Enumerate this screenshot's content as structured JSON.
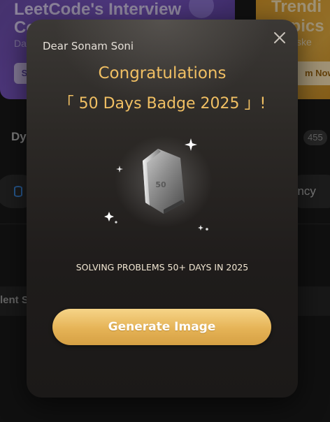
{
  "background": {
    "banner_left": {
      "title_line1": "LeetCode's Interview",
      "title_line2": "Co",
      "subtitle": "Da",
      "button": "S"
    },
    "banner_right": {
      "title_line1": "Trendi",
      "title_line2": "Topics",
      "subtitle": "-Aske",
      "button": "m Now"
    },
    "section_label": "Dy",
    "count_badge": "455",
    "right_pill_label": "ency",
    "row_label": "lent S"
  },
  "modal": {
    "greeting": "Dear Sonam Soni",
    "congrats": "Congratulations",
    "badge_title": "「 50 Days Badge 2025 」!",
    "badge_icon": "hexagon-badge-icon",
    "badge_mark": "50",
    "subtitle": "SOLVING PROBLEMS 50+ DAYS IN 2025",
    "generate_button": "Generate Image",
    "close_icon": "close-icon"
  },
  "colors": {
    "accent_gold": "#f0bf63",
    "button_gold": "#e5b356",
    "modal_bg": "#2c2926"
  }
}
